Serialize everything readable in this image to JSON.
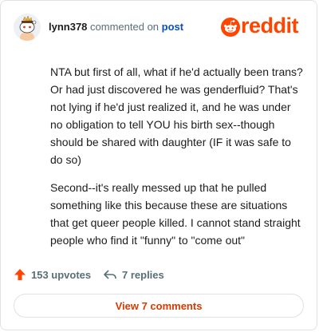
{
  "comment": {
    "username": "lynn378",
    "action_text": "commented on",
    "target_link": "post",
    "paragraphs": [
      "NTA but first of all, what if he'd actually been trans? Or had just discovered he was genderfluid? That's not lying if he'd just realized it, and he was under no obligation to tell YOU his birth sex--though should be shared with daughter (IF it was safe to do so)",
      "Second--it's really messed up that he pulled something like this because these are situations that get queer people killed. I cannot stand straight people who find it \"funny\" to \"come out\""
    ]
  },
  "brand": {
    "logo_text": "reddit",
    "logo_icon": "reddit-snoo-icon",
    "accent_color": "#ff4500"
  },
  "actions": {
    "upvotes_label": "153 upvotes",
    "upvote_icon": "upvote-arrow-icon",
    "replies_label": "7 replies",
    "reply_icon": "reply-arrow-icon"
  },
  "footer": {
    "view_comments_label": "View 7 comments"
  }
}
